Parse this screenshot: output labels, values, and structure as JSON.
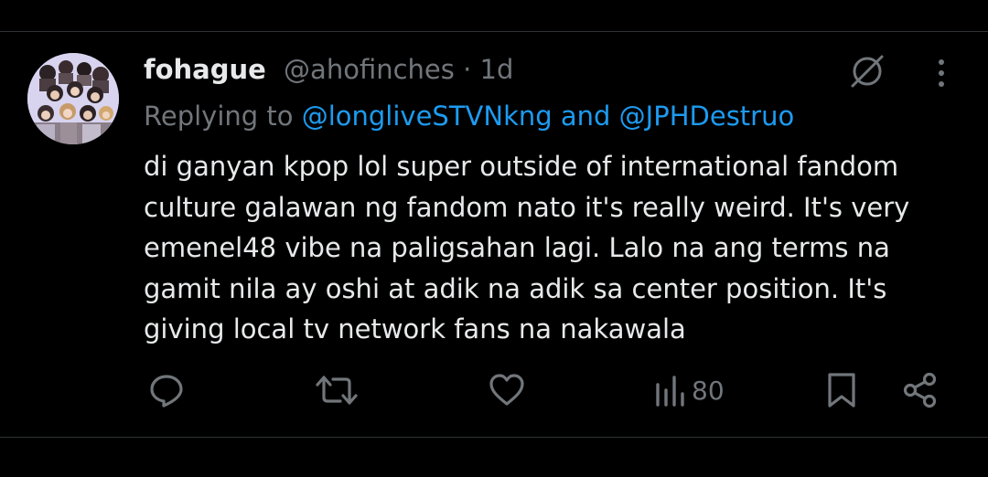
{
  "author": {
    "display_name": "fohague",
    "handle": "@ahofinches",
    "separator": "·",
    "time": "1d"
  },
  "reply": {
    "prefix": "Replying to",
    "mention_1": "@longliveSTVNkng",
    "conjunction": "and",
    "mention_2": "@JPHDestruo"
  },
  "body_lines": [
    "di ganyan kpop lol super outside of international fandom",
    "culture galawan ng fandom nato it's really weird. It's very",
    "emenel48 vibe na paligsahan lagi. Lalo na ang terms na",
    "gamit nila ay oshi at adik na adik sa center position. It's",
    "giving local tv network fans na nakawala"
  ],
  "actions": {
    "views_count": "80"
  },
  "icons": {
    "top_right": [
      "grok-icon",
      "more-icon"
    ],
    "action_bar": [
      "reply-icon",
      "retweet-icon",
      "like-icon",
      "views-icon",
      "bookmark-icon",
      "share-icon"
    ]
  },
  "colors": {
    "background": "#000000",
    "text": "#e7e9ea",
    "muted": "#71767b",
    "link": "#1d9bf0",
    "divider": "#2f3336"
  }
}
